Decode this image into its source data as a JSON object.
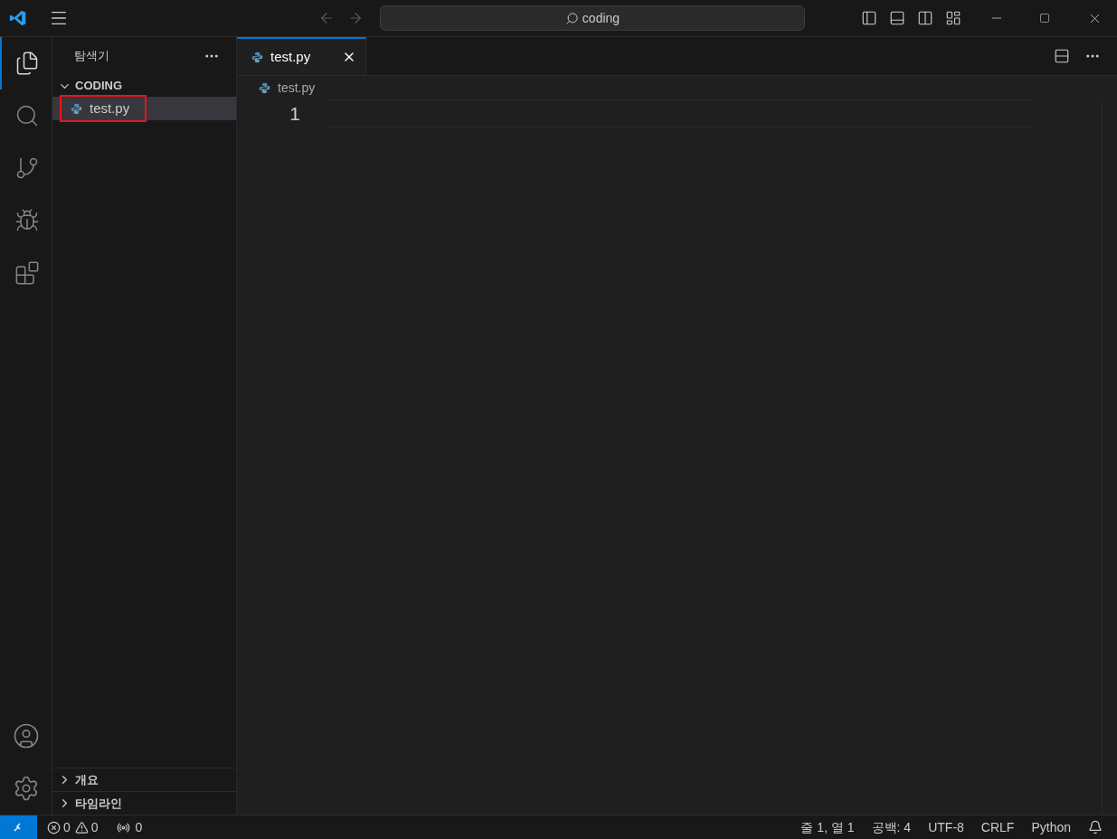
{
  "title_bar": {
    "search": "coding"
  },
  "activity_bar": [
    {
      "kind": "explorer",
      "selected": true
    },
    {
      "kind": "search",
      "selected": false
    },
    {
      "kind": "source-control",
      "selected": false
    },
    {
      "kind": "run-debug",
      "selected": false
    },
    {
      "kind": "extensions",
      "selected": false
    }
  ],
  "activity_bottom": [
    {
      "kind": "account"
    },
    {
      "kind": "settings"
    }
  ],
  "sidebar": {
    "title": "탐색기",
    "folder": {
      "name": "CODING",
      "expanded": true,
      "files": [
        {
          "name": "test.py",
          "selected": true,
          "highlighted": true
        }
      ]
    },
    "sections": [
      {
        "label": "개요",
        "expanded": false
      },
      {
        "label": "타임라인",
        "expanded": false
      }
    ]
  },
  "tabs": [
    {
      "label": "test.py",
      "selected": true
    }
  ],
  "breadcrumb": [
    "test.py"
  ],
  "editor": {
    "line_numbers": [
      "1"
    ]
  },
  "status_bar": {
    "errors": "0",
    "warnings": "0",
    "ports": "0",
    "items": [
      "줄 1, 열 1",
      "공백: 4",
      "UTF-8",
      "CRLF",
      "Python"
    ]
  }
}
